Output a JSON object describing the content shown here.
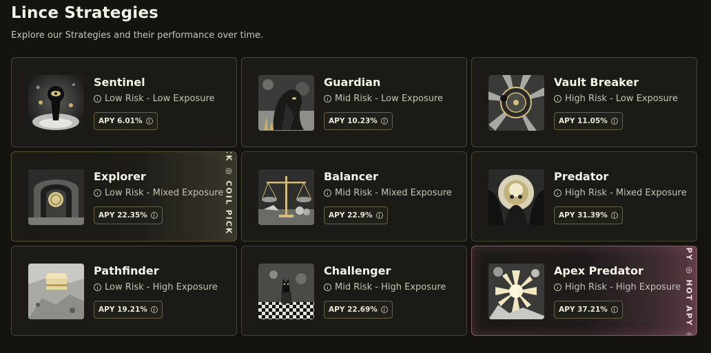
{
  "header": {
    "title": "Lince Strategies",
    "subtitle": "Explore our Strategies and their performance over time."
  },
  "strategies": [
    {
      "name": "Sentinel",
      "risk": "Low Risk - Low Exposure",
      "apy": "APY 6.01%",
      "icon": "keyhole-eye-icon"
    },
    {
      "name": "Guardian",
      "risk": "Mid Risk - Low Exposure",
      "apy": "APY 10.23%",
      "icon": "panther-guard-icon"
    },
    {
      "name": "Vault Breaker",
      "risk": "High Risk - Low Exposure",
      "apy": "APY 11.05%",
      "icon": "vault-dial-icon"
    },
    {
      "name": "Explorer",
      "risk": "Low Risk - Mixed Exposure",
      "apy": "APY 22.35%",
      "icon": "tunnel-coin-icon",
      "ribbon": "ICK ◎ COIL PICK ◎"
    },
    {
      "name": "Balancer",
      "risk": "Mid Risk - Mixed Exposure",
      "apy": "APY 22.9%",
      "icon": "scales-icon"
    },
    {
      "name": "Predator",
      "risk": "High Risk - Mixed Exposure",
      "apy": "APY 31.39%",
      "icon": "skull-claws-icon"
    },
    {
      "name": "Pathfinder",
      "risk": "Low Risk - High Exposure",
      "apy": "APY 19.21%",
      "icon": "treasure-chest-icon"
    },
    {
      "name": "Challenger",
      "risk": "Mid Risk - High Exposure",
      "apy": "APY 22.69%",
      "icon": "chess-cat-icon"
    },
    {
      "name": "Apex Predator",
      "risk": "High Risk - High Exposure",
      "apy": "APY 37.21%",
      "icon": "radiant-burst-icon",
      "ribbon": "APY ◎ HOT APY ◎"
    }
  ],
  "colors": {
    "background": "#141310",
    "card": "#1b1a16",
    "card_border": "#4a4530",
    "accent_gold": "#d8c58a",
    "hot_pink": "#c8708c"
  }
}
